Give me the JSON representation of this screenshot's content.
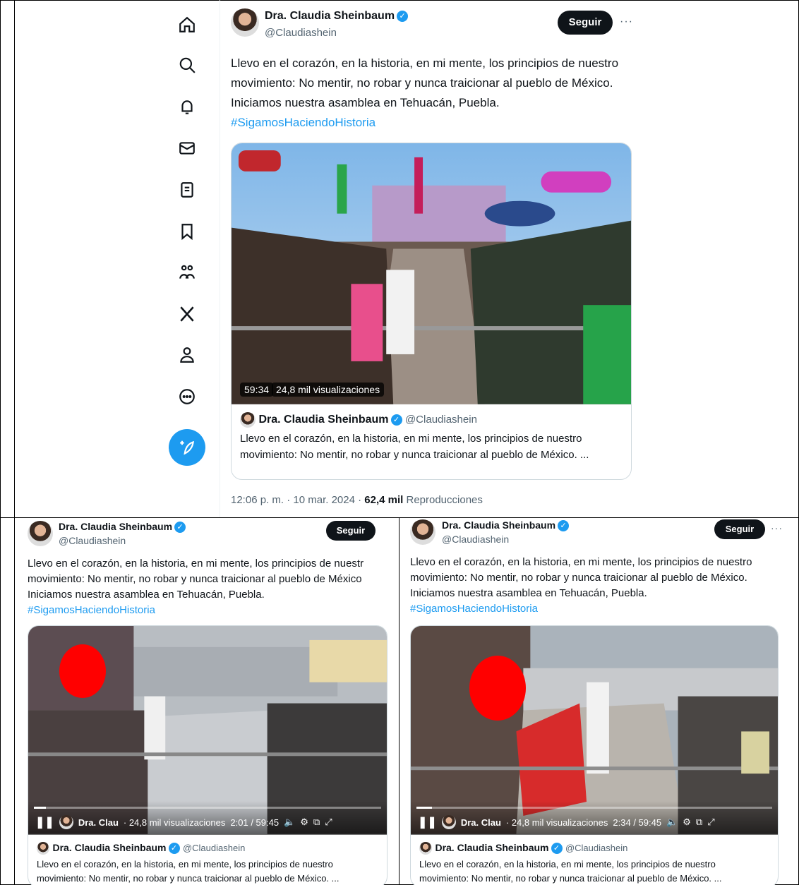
{
  "nav": {
    "items": [
      "home",
      "explore",
      "notifications",
      "messages",
      "lists",
      "bookmarks",
      "communities",
      "premium",
      "profile",
      "more"
    ]
  },
  "tweet": {
    "author_name": "Dra. Claudia Sheinbaum",
    "author_handle": "@Claudiashein",
    "follow_label": "Seguir",
    "more_label": "···",
    "text_lines": [
      "Llevo en el corazón, en la historia, en mi mente, los principios de nuestro",
      "movimiento: No mentir, no robar y nunca traicionar al pueblo de México.",
      "Iniciamos nuestra asamblea en Tehuacán, Puebla."
    ],
    "hashtag": "#SigamosHaciendoHistoria",
    "video": {
      "duration": "59:34",
      "views": "24,8 mil visualizaciones"
    },
    "card": {
      "name": "Dra. Claudia Sheinbaum",
      "handle": "@Claudiashein",
      "text_line1": "Llevo en el corazón, en la historia, en mi mente, los principios de nuestro",
      "text_line2": "movimiento: No mentir, no robar y nunca traicionar al pueblo de México. ..."
    },
    "meta": {
      "time": "12:06 p. m. · 10 mar. 2024 · ",
      "views_count": "62,4 mil",
      "views_label": " Reproducciones"
    }
  },
  "panels": [
    {
      "name": "Dra. Claudia Sheinbaum",
      "handle": "@Claudiashein",
      "follow_label": "Seguir",
      "text_lines": [
        "Llevo en el corazón, en la historia, en mi mente, los principios de nuestr",
        "movimiento: No mentir, no robar y nunca traicionar al pueblo de México",
        "Iniciamos nuestra asamblea en Tehuacán, Puebla."
      ],
      "hashtag": "#SigamosHaciendoHistoria",
      "player": {
        "author": "Dra. Clau",
        "views": "· 24,8 mil visualizaciones",
        "time": "2:01 / 59:45",
        "progress": 0.034
      },
      "card": {
        "name": "Dra. Claudia Sheinbaum",
        "handle": "@Claudiashein",
        "text_line1": "Llevo en el corazón, en la historia, en mi mente, los principios de nuestro",
        "text_line2": "movimiento: No mentir, no robar y nunca traicionar al pueblo de México. ..."
      }
    },
    {
      "name": "Dra. Claudia Sheinbaum",
      "handle": "@Claudiashein",
      "follow_label": "Seguir",
      "more_label": "···",
      "text_lines": [
        "Llevo en el corazón, en la historia, en mi mente, los principios de nuestro",
        "movimiento: No mentir, no robar y nunca traicionar al pueblo de México.",
        "Iniciamos nuestra asamblea en Tehuacán, Puebla."
      ],
      "hashtag": "#SigamosHaciendoHistoria",
      "player": {
        "author": "Dra. Clau",
        "views": "· 24,8 mil visualizaciones",
        "time": "2:34 / 59:45",
        "progress": 0.043
      },
      "card": {
        "name": "Dra. Claudia Sheinbaum",
        "handle": "@Claudiashein",
        "text_line1": "Llevo en el corazón, en la historia, en mi mente, los principios de nuestro",
        "text_line2": "movimiento: No mentir, no robar y nunca traicionar al pueblo de México. ..."
      }
    }
  ],
  "colors": {
    "accent": "#1d9bf0",
    "text": "#0f1419",
    "muted": "#536471",
    "censor": "#ff0000"
  }
}
